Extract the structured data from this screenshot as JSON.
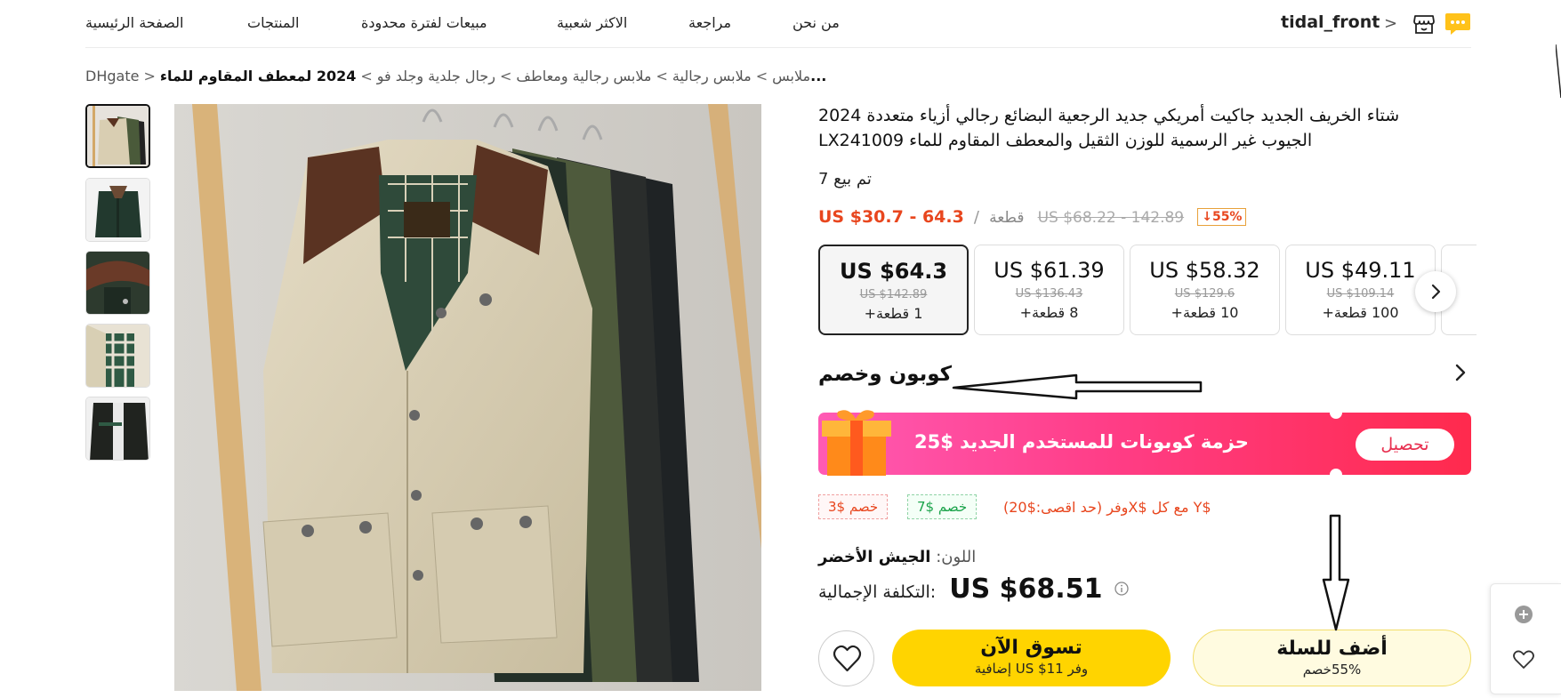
{
  "nav": {
    "links": [
      "الصفحة الرئيسية",
      "المنتجات",
      "مبيعات لفترة محدودة",
      "الاكثر شعبية",
      "مراجعة",
      "من نحن"
    ],
    "store_name": "tidal_front",
    "store_chevron": ">"
  },
  "breadcrumb": {
    "items": [
      "DHgate",
      "ملابس",
      "ملابس رجالية",
      "ملابس رجالية ومعاطف",
      "رجال جلدية وجلد فو"
    ],
    "separator": ">",
    "current": "2024 لمعطف المقاوم للماء..."
  },
  "product": {
    "title": "شتاء الخريف الجديد جاكيت أمريكي جديد الرجعية البضائع رجالي أزياء متعددة 2024 الجيوب غير الرسمية للوزن الثقيل والمعطف المقاوم للماء LX241009",
    "sold": "تم بيع 7",
    "price_range": "US $30.7 - 64.3",
    "unit": "قطعة",
    "slash": "/",
    "original_range": "US $68.22 - 142.89",
    "discount_badge": "↓55%",
    "tiers": [
      {
        "price": "US $64.3",
        "original": "US $142.89",
        "qty": "1 قطعة+"
      },
      {
        "price": "US $61.39",
        "original": "US $136.43",
        "qty": "8 قطعة+"
      },
      {
        "price": "US $58.32",
        "original": "US $129.6",
        "qty": "10 قطعة+"
      },
      {
        "price": "US $49.11",
        "original": "US $109.14",
        "qty": "100 قطعة+"
      }
    ]
  },
  "coupon": {
    "title": "كوبون وخصم",
    "banner_text": "حزمة كوبونات للمستخدم الجديد $25",
    "claim_label": "تحصيل",
    "chips": [
      "خصم $3",
      "خصم $7"
    ],
    "promo_text": "$Y مع كل $Xوفر  (حد اقصى:$20)"
  },
  "color": {
    "label": "اللون:",
    "value": "الجيش الأخضر"
  },
  "total": {
    "label": "التكلفة الإجمالية:",
    "value": "US $68.51"
  },
  "actions": {
    "buy_now": "تسوق الآن",
    "buy_now_sub": "وفر US $11 إضافية",
    "add_to_cart": "أضف للسلة",
    "add_to_cart_sub": "55%خصم"
  },
  "colors": {
    "accent_yellow": "#ffd400",
    "price_red": "#e8461e",
    "coupon_pink": "#ff3d86",
    "green": "#1aa34a"
  },
  "icons": [
    "store-icon",
    "message-icon",
    "chevron-right-icon",
    "gift-icon",
    "info-icon",
    "heart-icon",
    "plus-icon"
  ]
}
